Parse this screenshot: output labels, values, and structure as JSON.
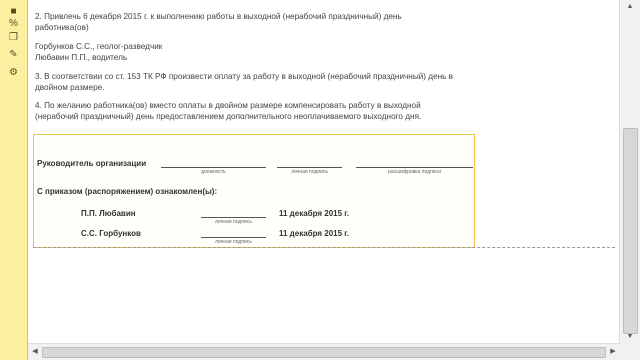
{
  "toolbar": {
    "icons": [
      "document-icon",
      "percent-icon",
      "copy-icon",
      "wrench-icon",
      "gear-icon"
    ],
    "glyphs": [
      "■",
      "%",
      "❐",
      "✎",
      "⚙"
    ]
  },
  "document": {
    "paragraphs": [
      "2. Привлечь 6 декабря 2015 г. к выполнению работы в выходной (нерабочий праздничный) день",
      "работника(ов)",
      "Горбунков С.С., геолог-разведчик",
      "Любавин П.П., водитель",
      "3. В соответствии со ст. 153 ТК РФ произвести оплату за работу в выходной (нерабочий праздничный)  день в",
      "двойном размере.",
      "4. По желанию работника(ов) вместо оплаты в двойном размере компенсировать работу в выходной",
      "(нерабочий праздничный) день предоставлением дополнительного неоплачиваемого выходного дня."
    ],
    "signatures": {
      "head_label": "Руководитель организации",
      "caption_position": "должность",
      "caption_signature": "личная подпись",
      "caption_decoding": "расшифровка  подписи",
      "acquainted_label": "С приказом (распоряжением) ознакомлен(ы):",
      "employees": [
        {
          "name": "П.П. Любавин",
          "caption": "личная подпись",
          "date": "11 декабря 2015 г."
        },
        {
          "name": "С.С. Горбунков",
          "caption": "личная подпись",
          "date": "11 декабря 2015 г."
        }
      ]
    }
  },
  "colors": {
    "toolbar_bg": "#fbf0a0",
    "section_border": "#e6c64a"
  }
}
